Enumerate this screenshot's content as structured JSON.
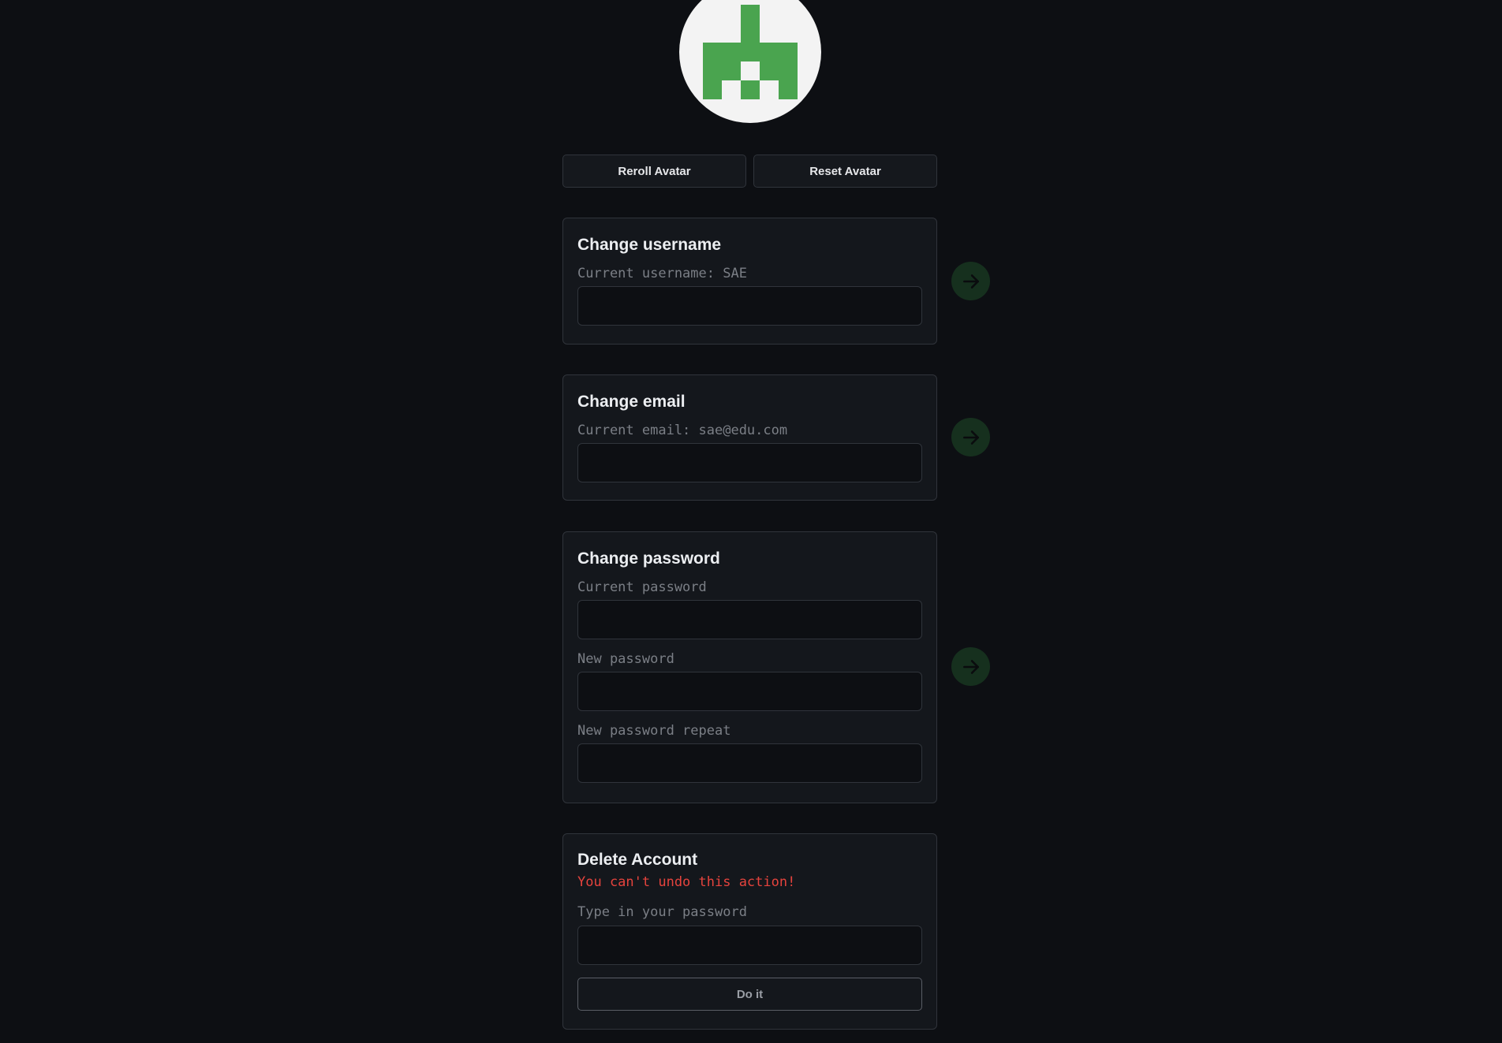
{
  "avatar": {
    "icon": "pixel-identicon",
    "foreground": "#4aa44f",
    "background": "#f3f3f3"
  },
  "avatar_actions": {
    "reroll_label": "Reroll Avatar",
    "reset_label": "Reset Avatar"
  },
  "username_card": {
    "title": "Change username",
    "label": "Current username: SAE",
    "value": ""
  },
  "email_card": {
    "title": "Change email",
    "label": "Current email: sae@edu.com",
    "value": ""
  },
  "password_card": {
    "title": "Change password",
    "current_label": "Current password",
    "new_label": "New password",
    "repeat_label": "New password repeat"
  },
  "delete_card": {
    "title": "Delete Account",
    "warning": "You can't undo this action!",
    "label": "Type in your password",
    "button_label": "Do it"
  },
  "submit_icon": "arrow-right-icon",
  "colors": {
    "background": "#0d0f13",
    "card": "#14171c",
    "border": "#30343b",
    "accent_green": "#16301e",
    "danger": "#e5433d"
  }
}
